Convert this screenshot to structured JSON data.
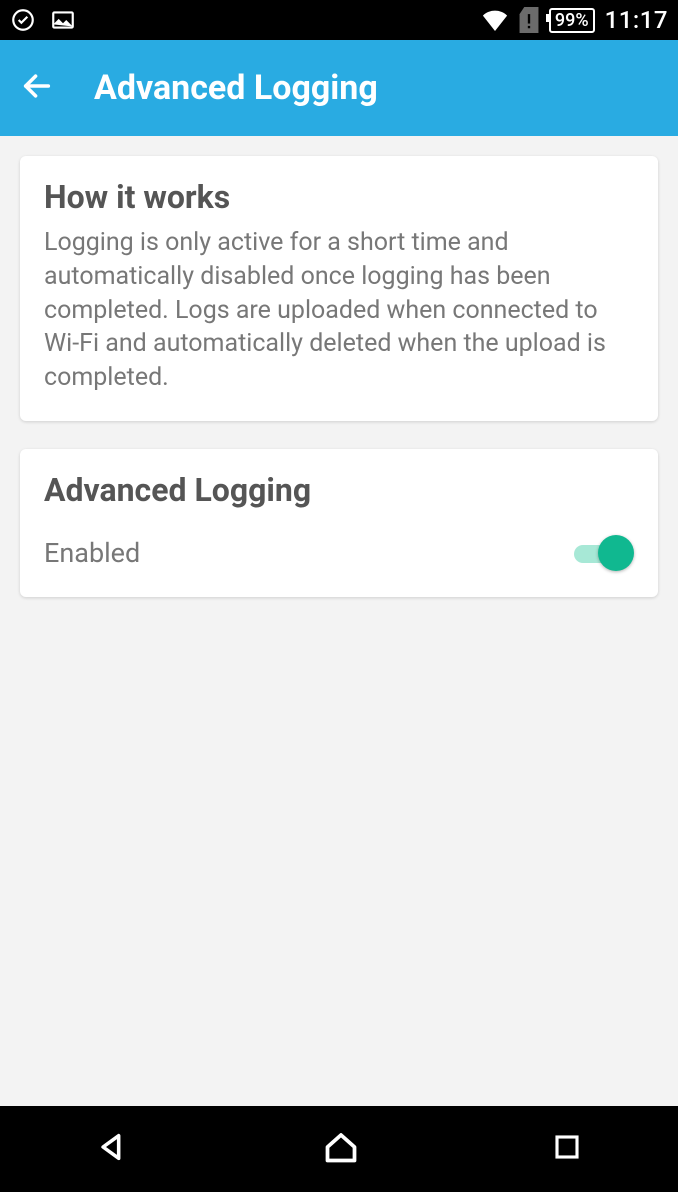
{
  "statusBar": {
    "batteryText": "99%",
    "time": "11:17"
  },
  "appBar": {
    "title": "Advanced Logging"
  },
  "howItWorks": {
    "title": "How it works",
    "body": "Logging is only active for a short time and automatically disabled once logging has been completed. Logs are uploaded when connected to Wi-Fi and automatically deleted when the upload is completed."
  },
  "advancedLogging": {
    "title": "Advanced Logging",
    "toggleLabel": "Enabled",
    "toggleOn": true
  }
}
